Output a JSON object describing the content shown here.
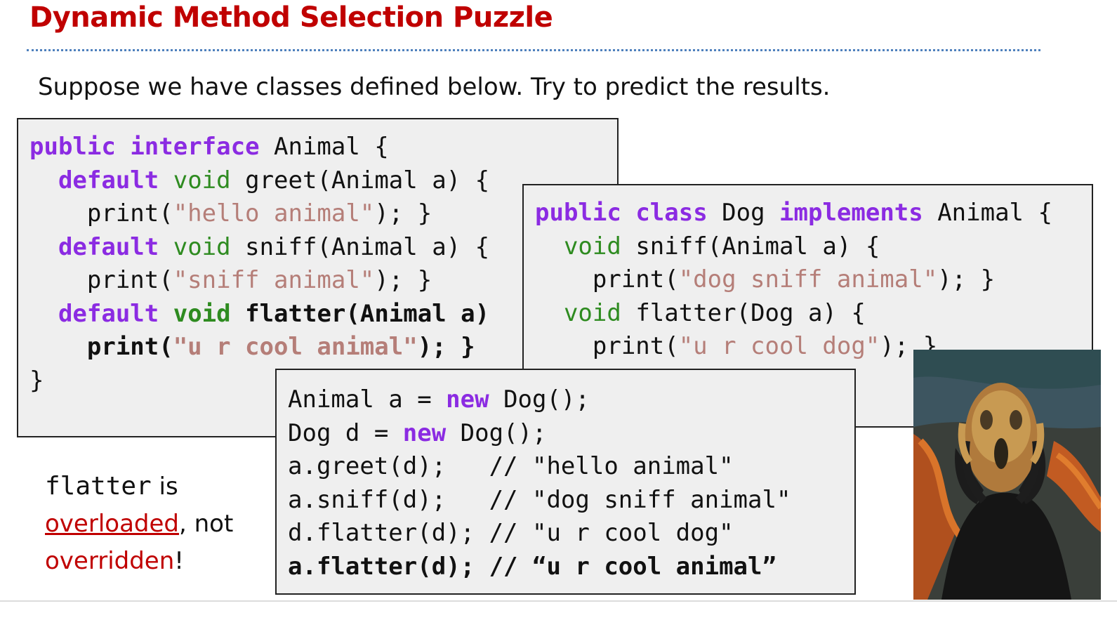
{
  "slide": {
    "title": "Dynamic Method Selection Puzzle",
    "subtitle": "Suppose we have classes defined below. Try to predict the results."
  },
  "animal_interface": {
    "line1": {
      "kw1": "public",
      "kw2": "interface",
      "rest": " Animal {"
    },
    "greet": {
      "indent": "  ",
      "kw": "default",
      "type": "void",
      "rest": " greet(Animal a) {"
    },
    "greet_body": {
      "pre": "    print(",
      "str": "\"hello animal\"",
      "post": "); }"
    },
    "sniff": {
      "indent": "  ",
      "kw": "default",
      "type": "void",
      "rest": " sniff(Animal a) {"
    },
    "sniff_body": {
      "pre": "    print(",
      "str": "\"sniff animal\"",
      "post": "); }"
    },
    "flatter": {
      "indent": "  ",
      "kw": "default",
      "type": "void",
      "rest": " flatter(Animal a)"
    },
    "flatter_body": {
      "pre": "    print(",
      "str": "\"u r cool animal\"",
      "post": "); }"
    },
    "close": "}"
  },
  "dog_class": {
    "line1": {
      "kw1": "public",
      "kw2": "class",
      "mid": " Dog ",
      "kw3": "implements",
      "rest": " Animal {"
    },
    "sniff": {
      "indent": "  ",
      "type": "void",
      "rest": " sniff(Animal a) {"
    },
    "sniff_body": {
      "pre": "    print(",
      "str": "\"dog sniff animal\"",
      "post": "); }"
    },
    "flatter": {
      "indent": "  ",
      "type": "void",
      "rest": " flatter(Dog a) {"
    },
    "flatter_body": {
      "pre": "    print(",
      "str": "\"u r cool dog\"",
      "post": "); }"
    }
  },
  "test_code": {
    "line1": {
      "pre": "Animal a = ",
      "kw": "new",
      "post": " Dog();"
    },
    "line2": {
      "pre": "Dog d = ",
      "kw": "new",
      "post": " Dog();"
    },
    "line3": "a.greet(d);   // \"hello animal\"",
    "line4": "a.sniff(d);   // \"dog sniff animal\"",
    "line5": "d.flatter(d); // \"u r cool dog\"",
    "line6": "a.flatter(d); // “u r cool animal”"
  },
  "note": {
    "code_word": "flatter",
    "is": " is",
    "overloaded": "overloaded",
    "not": ", not",
    "overridden": "overridden",
    "bang": "!"
  },
  "colors": {
    "title": "#c00000",
    "keyword": "#8b2be2",
    "type": "#2e8b20",
    "string": "#b57e78",
    "code_bg": "#efefef"
  }
}
